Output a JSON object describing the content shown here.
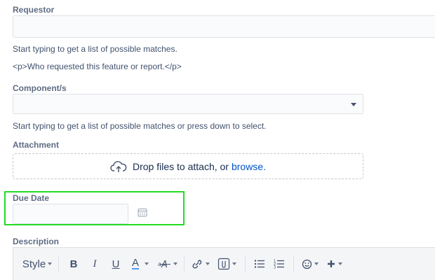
{
  "requestor": {
    "label": "Requestor",
    "value": "",
    "help": "Start typing to get a list of possible matches.",
    "description": "<p>Who requested this feature or report.</p>"
  },
  "components": {
    "label": "Component/s",
    "value": "",
    "help": "Start typing to get a list of possible matches or press down to select."
  },
  "attachment": {
    "label": "Attachment",
    "drop_text": "Drop files to attach, or",
    "browse_text": "browse."
  },
  "due_date": {
    "label": "Due Date",
    "value": ""
  },
  "description": {
    "label": "Description",
    "toolbar": {
      "style_label": "Style",
      "bold": "B",
      "italic": "I",
      "underline": "U",
      "text_color": "A"
    }
  },
  "colors": {
    "highlight": "#22dd22",
    "link": "#0052cc",
    "label": "#5e6c84"
  }
}
